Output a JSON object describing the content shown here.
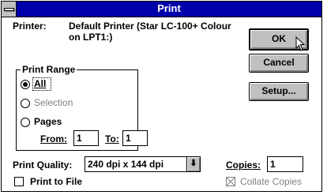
{
  "window": {
    "title": "Print"
  },
  "printer": {
    "label": "Printer:",
    "value_line1": "Default Printer (Star LC-100+ Colour",
    "value_line2": "on LPT1:)"
  },
  "buttons": {
    "ok": "OK",
    "cancel": "Cancel",
    "setup": "Setup..."
  },
  "print_range": {
    "title": "Print Range",
    "options": [
      {
        "label": "All",
        "selected": true,
        "enabled": true
      },
      {
        "label": "Selection",
        "selected": false,
        "enabled": false
      },
      {
        "label": "Pages",
        "selected": false,
        "enabled": true
      }
    ],
    "from_label": "From:",
    "from_value": "1",
    "to_label": "To:",
    "to_value": "1"
  },
  "quality": {
    "label": "Print Quality:",
    "value": "240 dpi x 144 dpi"
  },
  "copies": {
    "label": "Copies:",
    "value": "1"
  },
  "print_to_file": {
    "label": "Print to File",
    "checked": false
  },
  "collate": {
    "label": "Collate Copies",
    "checked": true,
    "enabled": false
  }
}
